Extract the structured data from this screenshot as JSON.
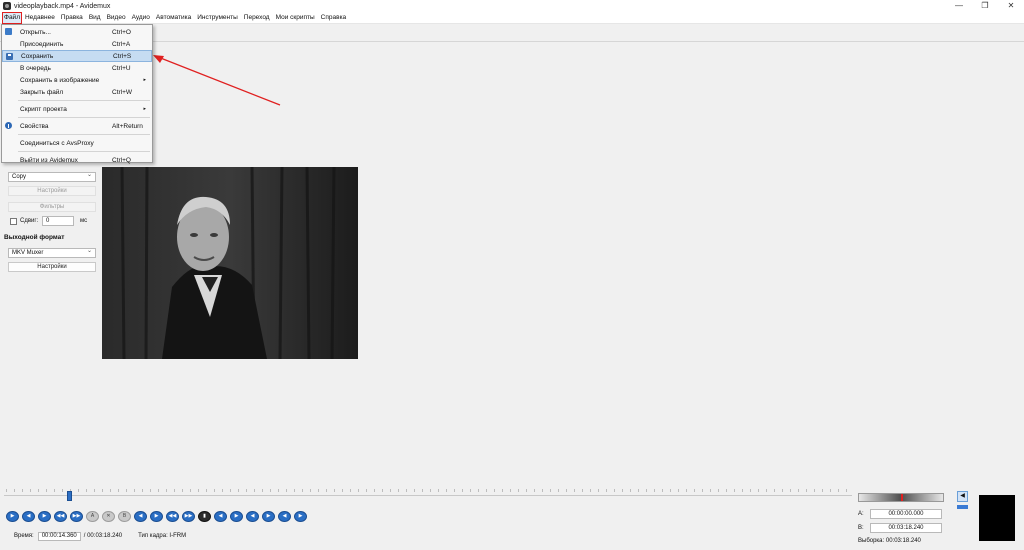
{
  "window": {
    "title": "videoplayback.mp4 - Avidemux",
    "minimize": "—",
    "restore": "❐",
    "close": "✕"
  },
  "menubar": [
    "Файл",
    "Недавнее",
    "Правка",
    "Вид",
    "Видео",
    "Аудио",
    "Автоматика",
    "Инструменты",
    "Переход",
    "Мои скрипты",
    "Справка"
  ],
  "file_menu": {
    "open": {
      "label": "Открыть...",
      "shortcut": "Ctrl+O"
    },
    "append": {
      "label": "Присоединить",
      "shortcut": "Ctrl+A"
    },
    "save": {
      "label": "Сохранить",
      "shortcut": "Ctrl+S"
    },
    "queue": {
      "label": "В очередь",
      "shortcut": "Ctrl+U"
    },
    "save_as_image": {
      "label": "Сохранить в изображение",
      "arrow": "▸"
    },
    "close_file": {
      "label": "Закрыть файл",
      "shortcut": "Ctrl+W"
    },
    "project_script": {
      "label": "Скрипт проекта",
      "arrow": "▸"
    },
    "properties": {
      "label": "Свойства",
      "shortcut": "Alt+Return"
    },
    "connect_avsproxy": {
      "label": "Соединиться с AvsProxy"
    },
    "quit": {
      "label": "Выйти из Avidemux",
      "shortcut": "Ctrl+Q"
    }
  },
  "left_panel": {
    "audio_codec": "Copy",
    "audio_config_button": "Настройки",
    "audio_filters_button": "Фильтры",
    "shift_label": "Сдвиг:",
    "shift_value": "0",
    "shift_unit": "мс",
    "output_format_heading": "Выходной формат",
    "output_format": "MKV Muxer",
    "output_config_button": "Настройки"
  },
  "status": {
    "time_label": "Время:",
    "time_value": "00:00:14.360",
    "duration": "/ 00:03:18.240",
    "frame_type": "Тип кадра: I-FRM"
  },
  "selection": {
    "a_label": "A:",
    "a_value": "00:00:00.000",
    "b_label": "B:",
    "b_value": "00:03:18.240",
    "selection_text": "Выборка: 00:03:18.240"
  },
  "navigation_buttons": [
    "▶",
    "◀",
    "▶",
    "◀◀",
    "▶▶",
    "A",
    "✕",
    "B",
    "◀",
    "▶",
    "◀◀",
    "▶▶",
    "▮",
    "◀",
    "▶",
    "◀",
    "▶",
    "◀",
    "▶"
  ],
  "timeline_position": 0.074,
  "colors": {
    "accent": "#2a6ec4",
    "highlight": "#c6dcf2",
    "annotation": "#e02020"
  }
}
